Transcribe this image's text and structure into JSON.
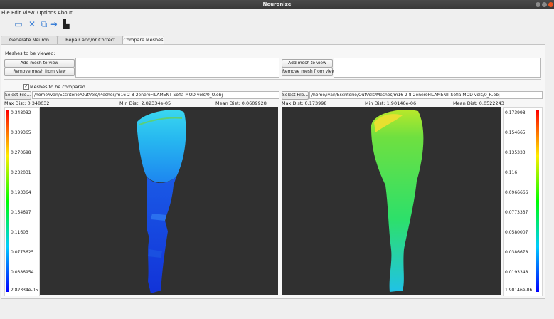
{
  "window": {
    "title": "Neuronize"
  },
  "menu": [
    "File",
    "Edit",
    "View",
    "Options",
    "About"
  ],
  "toolbar_icons": [
    "monitor-icon",
    "tools-icon",
    "copy-icon",
    "redo-arrow-icon",
    "camera-icon"
  ],
  "tabs": [
    "Generate Neuron",
    "Repair and/or Correct Meshes",
    "Compare Meshes"
  ],
  "active_tab": "Compare Meshes",
  "meshes_label": "Meshes to be viewed:",
  "add_mesh_label": "Add mesh to view",
  "remove_mesh_label": "Remove mesh from view",
  "compare_checkbox": {
    "label": "Meshes to be compared",
    "checked": true,
    "mark": "✓"
  },
  "select_file_label": "Select File...",
  "left": {
    "path": "/home/ivan/Escritorio/OutVols/Meshes/m16 2 8-2eneroFILAMENT Sofia MOD vols/0_O.obj",
    "max": "Max Dist: 0.348032",
    "min": "Min Dist: 2.82334e-05",
    "mean": "Mean Dist: 0.0609928",
    "ticks": [
      "0.348032",
      "0.309365",
      "0.270698",
      "0.232031",
      "0.193364",
      "0.154697",
      "0.11603",
      "0.0773625",
      "0.0386954",
      "2.82334e-05"
    ]
  },
  "right": {
    "path": "/home/ivan/Escritorio/OutVols/Meshes/m16 2 8-2eneroFILAMENT Sofia MOD vols/0_R.obj",
    "max": "Max Dist: 0.173998",
    "min": "Min Dist: 1.90146e-06",
    "mean": "Mean Dist: 0.0522243",
    "ticks": [
      "0.173998",
      "0.154665",
      "0.135333",
      "0.116",
      "0.0966666",
      "0.0773337",
      "0.0580007",
      "0.0386678",
      "0.0193348",
      "1.90146e-06"
    ]
  },
  "colors": {
    "viewport_bg": "#303030",
    "scale_gradient": [
      "#ff0000",
      "#ffee00",
      "#00ff00",
      "#00ccff",
      "#0000ff"
    ]
  }
}
